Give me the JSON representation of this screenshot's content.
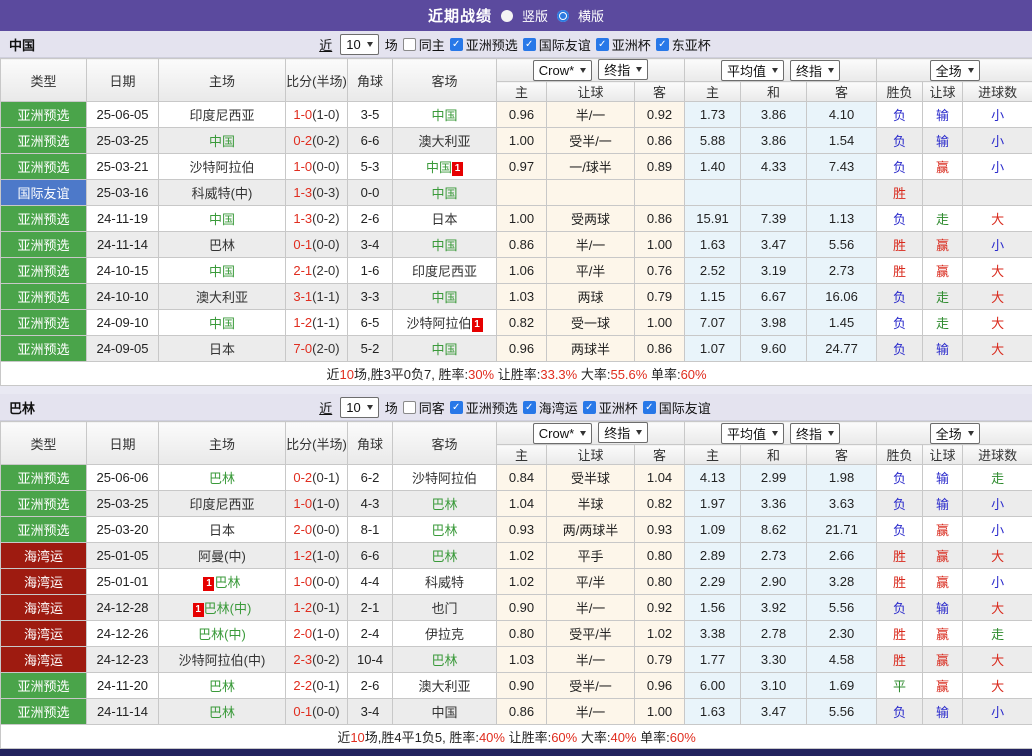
{
  "title_bar": {
    "title": "近期战绩",
    "radios": [
      {
        "label": "竖版",
        "selected": false
      },
      {
        "label": "横版",
        "selected": true
      }
    ]
  },
  "colors": {
    "accent_purple": "#5b4a9e",
    "type_badge": {
      "亚洲预选": "#4aa44a",
      "国际友谊": "#4d79c9",
      "海湾运": "#9e1b10"
    },
    "result": {
      "胜": "#d9291c",
      "负": "#2b2bcc",
      "平": "#2e8b2e",
      "赢": "#d9291c",
      "输": "#2b2bcc",
      "走": "#2e8b2e",
      "大": "#d9291c",
      "小": "#2b2bcc"
    },
    "score_red": "#e02d1f",
    "team_green": "#3a9a3a",
    "badge_red": "#e60000"
  },
  "table_header": {
    "left_columns": [
      "类型",
      "日期",
      "主场",
      "比分(半场)",
      "角球",
      "客场"
    ],
    "selects": {
      "group1": [
        "Crow*",
        "终指"
      ],
      "group2": [
        "平均值",
        "终指"
      ],
      "group3": [
        "全场"
      ]
    },
    "sub_columns": [
      "主",
      "让球",
      "客",
      "主",
      "和",
      "客",
      "胜负",
      "让球",
      "进球数"
    ]
  },
  "sections": [
    {
      "team": "中国",
      "filter": {
        "prefix": "近",
        "count": "10",
        "suffix": "场",
        "same": {
          "label": "同主",
          "checked": false
        },
        "leagues": [
          {
            "label": "亚洲预选",
            "checked": true
          },
          {
            "label": "国际友谊",
            "checked": true
          },
          {
            "label": "亚洲杯",
            "checked": true
          },
          {
            "label": "东亚杯",
            "checked": true
          }
        ]
      },
      "rows": [
        {
          "type": "亚洲预选",
          "date": "25-06-05",
          "home": {
            "name": "印度尼西亚"
          },
          "score": {
            "ft": "1-0",
            "ht": "(1-0)"
          },
          "corner": "3-5",
          "away": {
            "name": "中国",
            "green": true
          },
          "crow": [
            "0.96",
            "半/一",
            "0.92"
          ],
          "avg": [
            "1.73",
            "3.86",
            "4.10"
          ],
          "result": [
            "负",
            "输",
            "小"
          ]
        },
        {
          "type": "亚洲预选",
          "date": "25-03-25",
          "home": {
            "name": "中国",
            "green": true
          },
          "score": {
            "ft": "0-2",
            "ht": "(0-2)"
          },
          "corner": "6-6",
          "away": {
            "name": "澳大利亚"
          },
          "crow": [
            "1.00",
            "受半/一",
            "0.86"
          ],
          "avg": [
            "5.88",
            "3.86",
            "1.54"
          ],
          "result": [
            "负",
            "输",
            "小"
          ]
        },
        {
          "type": "亚洲预选",
          "date": "25-03-21",
          "home": {
            "name": "沙特阿拉伯"
          },
          "score": {
            "ft": "1-0",
            "ht": "(0-0)"
          },
          "corner": "5-3",
          "away": {
            "name": "中国",
            "green": true,
            "badge": "1",
            "badge_pos": "after"
          },
          "crow": [
            "0.97",
            "一/球半",
            "0.89"
          ],
          "avg": [
            "1.40",
            "4.33",
            "7.43"
          ],
          "result": [
            "负",
            "赢",
            "小"
          ]
        },
        {
          "type": "国际友谊",
          "date": "25-03-16",
          "home": {
            "name": "科威特(中)"
          },
          "score": {
            "ft": "1-3",
            "ht": "(0-3)"
          },
          "corner": "0-0",
          "away": {
            "name": "中国",
            "green": true
          },
          "crow": [
            "",
            "",
            ""
          ],
          "avg": [
            "",
            "",
            ""
          ],
          "result": [
            "胜",
            "",
            ""
          ]
        },
        {
          "type": "亚洲预选",
          "date": "24-11-19",
          "home": {
            "name": "中国",
            "green": true
          },
          "score": {
            "ft": "1-3",
            "ht": "(0-2)"
          },
          "corner": "2-6",
          "away": {
            "name": "日本"
          },
          "crow": [
            "1.00",
            "受两球",
            "0.86"
          ],
          "avg": [
            "15.91",
            "7.39",
            "1.13"
          ],
          "result": [
            "负",
            "走",
            "大"
          ]
        },
        {
          "type": "亚洲预选",
          "date": "24-11-14",
          "home": {
            "name": "巴林"
          },
          "score": {
            "ft": "0-1",
            "ht": "(0-0)"
          },
          "corner": "3-4",
          "away": {
            "name": "中国",
            "green": true
          },
          "crow": [
            "0.86",
            "半/一",
            "1.00"
          ],
          "avg": [
            "1.63",
            "3.47",
            "5.56"
          ],
          "result": [
            "胜",
            "赢",
            "小"
          ]
        },
        {
          "type": "亚洲预选",
          "date": "24-10-15",
          "home": {
            "name": "中国",
            "green": true
          },
          "score": {
            "ft": "2-1",
            "ht": "(2-0)"
          },
          "corner": "1-6",
          "away": {
            "name": "印度尼西亚"
          },
          "crow": [
            "1.06",
            "平/半",
            "0.76"
          ],
          "avg": [
            "2.52",
            "3.19",
            "2.73"
          ],
          "result": [
            "胜",
            "赢",
            "大"
          ]
        },
        {
          "type": "亚洲预选",
          "date": "24-10-10",
          "home": {
            "name": "澳大利亚"
          },
          "score": {
            "ft": "3-1",
            "ht": "(1-1)"
          },
          "corner": "3-3",
          "away": {
            "name": "中国",
            "green": true
          },
          "crow": [
            "1.03",
            "两球",
            "0.79"
          ],
          "avg": [
            "1.15",
            "6.67",
            "16.06"
          ],
          "result": [
            "负",
            "走",
            "大"
          ]
        },
        {
          "type": "亚洲预选",
          "date": "24-09-10",
          "home": {
            "name": "中国",
            "green": true
          },
          "score": {
            "ft": "1-2",
            "ht": "(1-1)"
          },
          "corner": "6-5",
          "away": {
            "name": "沙特阿拉伯",
            "badge": "1",
            "badge_pos": "after"
          },
          "crow": [
            "0.82",
            "受一球",
            "1.00"
          ],
          "avg": [
            "7.07",
            "3.98",
            "1.45"
          ],
          "result": [
            "负",
            "走",
            "大"
          ]
        },
        {
          "type": "亚洲预选",
          "date": "24-09-05",
          "home": {
            "name": "日本"
          },
          "score": {
            "ft": "7-0",
            "ht": "(2-0)"
          },
          "corner": "5-2",
          "away": {
            "name": "中国",
            "green": true
          },
          "crow": [
            "0.96",
            "两球半",
            "0.86"
          ],
          "avg": [
            "1.07",
            "9.60",
            "24.77"
          ],
          "result": [
            "负",
            "输",
            "大"
          ]
        }
      ],
      "summary": [
        {
          "text": "近",
          "red": false
        },
        {
          "text": "10",
          "red": true
        },
        {
          "text": "场,胜3平0负7, 胜率:",
          "red": false
        },
        {
          "text": "30%",
          "red": true
        },
        {
          "text": " 让胜率:",
          "red": false
        },
        {
          "text": "33.3%",
          "red": true
        },
        {
          "text": " 大率:",
          "red": false
        },
        {
          "text": "55.6%",
          "red": true
        },
        {
          "text": " 单率:",
          "red": false
        },
        {
          "text": "60%",
          "red": true
        }
      ]
    },
    {
      "team": "巴林",
      "filter": {
        "prefix": "近",
        "count": "10",
        "suffix": "场",
        "same": {
          "label": "同客",
          "checked": false
        },
        "leagues": [
          {
            "label": "亚洲预选",
            "checked": true
          },
          {
            "label": "海湾运",
            "checked": true
          },
          {
            "label": "亚洲杯",
            "checked": true
          },
          {
            "label": "国际友谊",
            "checked": true
          }
        ]
      },
      "rows": [
        {
          "type": "亚洲预选",
          "date": "25-06-06",
          "home": {
            "name": "巴林",
            "green": true
          },
          "score": {
            "ft": "0-2",
            "ht": "(0-1)"
          },
          "corner": "6-2",
          "away": {
            "name": "沙特阿拉伯"
          },
          "crow": [
            "0.84",
            "受半球",
            "1.04"
          ],
          "avg": [
            "4.13",
            "2.99",
            "1.98"
          ],
          "result": [
            "负",
            "输",
            "走"
          ]
        },
        {
          "type": "亚洲预选",
          "date": "25-03-25",
          "home": {
            "name": "印度尼西亚"
          },
          "score": {
            "ft": "1-0",
            "ht": "(1-0)"
          },
          "corner": "4-3",
          "away": {
            "name": "巴林",
            "green": true
          },
          "crow": [
            "1.04",
            "半球",
            "0.82"
          ],
          "avg": [
            "1.97",
            "3.36",
            "3.63"
          ],
          "result": [
            "负",
            "输",
            "小"
          ]
        },
        {
          "type": "亚洲预选",
          "date": "25-03-20",
          "home": {
            "name": "日本"
          },
          "score": {
            "ft": "2-0",
            "ht": "(0-0)"
          },
          "corner": "8-1",
          "away": {
            "name": "巴林",
            "green": true
          },
          "crow": [
            "0.93",
            "两/两球半",
            "0.93"
          ],
          "avg": [
            "1.09",
            "8.62",
            "21.71"
          ],
          "result": [
            "负",
            "赢",
            "小"
          ]
        },
        {
          "type": "海湾运",
          "date": "25-01-05",
          "home": {
            "name": "阿曼(中)"
          },
          "score": {
            "ft": "1-2",
            "ht": "(1-0)"
          },
          "corner": "6-6",
          "away": {
            "name": "巴林",
            "green": true
          },
          "crow": [
            "1.02",
            "平手",
            "0.80"
          ],
          "avg": [
            "2.89",
            "2.73",
            "2.66"
          ],
          "result": [
            "胜",
            "赢",
            "大"
          ]
        },
        {
          "type": "海湾运",
          "date": "25-01-01",
          "home": {
            "name": "巴林",
            "green": true,
            "badge": "1",
            "badge_pos": "before"
          },
          "score": {
            "ft": "1-0",
            "ht": "(0-0)"
          },
          "corner": "4-4",
          "away": {
            "name": "科威特"
          },
          "crow": [
            "1.02",
            "平/半",
            "0.80"
          ],
          "avg": [
            "2.29",
            "2.90",
            "3.28"
          ],
          "result": [
            "胜",
            "赢",
            "小"
          ]
        },
        {
          "type": "海湾运",
          "date": "24-12-28",
          "home": {
            "name": "巴林(中)",
            "green": true,
            "badge": "1",
            "badge_pos": "before"
          },
          "score": {
            "ft": "1-2",
            "ht": "(0-1)"
          },
          "corner": "2-1",
          "away": {
            "name": "也门"
          },
          "crow": [
            "0.90",
            "半/一",
            "0.92"
          ],
          "avg": [
            "1.56",
            "3.92",
            "5.56"
          ],
          "result": [
            "负",
            "输",
            "大"
          ]
        },
        {
          "type": "海湾运",
          "date": "24-12-26",
          "home": {
            "name": "巴林(中)",
            "green": true
          },
          "score": {
            "ft": "2-0",
            "ht": "(1-0)"
          },
          "corner": "2-4",
          "away": {
            "name": "伊拉克"
          },
          "crow": [
            "0.80",
            "受平/半",
            "1.02"
          ],
          "avg": [
            "3.38",
            "2.78",
            "2.30"
          ],
          "result": [
            "胜",
            "赢",
            "走"
          ]
        },
        {
          "type": "海湾运",
          "date": "24-12-23",
          "home": {
            "name": "沙特阿拉伯(中)"
          },
          "score": {
            "ft": "2-3",
            "ht": "(0-2)"
          },
          "corner": "10-4",
          "away": {
            "name": "巴林",
            "green": true
          },
          "crow": [
            "1.03",
            "半/一",
            "0.79"
          ],
          "avg": [
            "1.77",
            "3.30",
            "4.58"
          ],
          "result": [
            "胜",
            "赢",
            "大"
          ]
        },
        {
          "type": "亚洲预选",
          "date": "24-11-20",
          "home": {
            "name": "巴林",
            "green": true
          },
          "score": {
            "ft": "2-2",
            "ht": "(0-1)"
          },
          "corner": "2-6",
          "away": {
            "name": "澳大利亚"
          },
          "crow": [
            "0.90",
            "受半/一",
            "0.96"
          ],
          "avg": [
            "6.00",
            "3.10",
            "1.69"
          ],
          "result": [
            "平",
            "赢",
            "大"
          ]
        },
        {
          "type": "亚洲预选",
          "date": "24-11-14",
          "home": {
            "name": "巴林",
            "green": true
          },
          "score": {
            "ft": "0-1",
            "ht": "(0-0)"
          },
          "corner": "3-4",
          "away": {
            "name": "中国"
          },
          "crow": [
            "0.86",
            "半/一",
            "1.00"
          ],
          "avg": [
            "1.63",
            "3.47",
            "5.56"
          ],
          "result": [
            "负",
            "输",
            "小"
          ]
        }
      ],
      "summary": [
        {
          "text": "近",
          "red": false
        },
        {
          "text": "10",
          "red": true
        },
        {
          "text": "场,胜4平1负5, 胜率:",
          "red": false
        },
        {
          "text": "40%",
          "red": true
        },
        {
          "text": " 让胜率:",
          "red": false
        },
        {
          "text": "60%",
          "red": true
        },
        {
          "text": " 大率:",
          "red": false
        },
        {
          "text": "40%",
          "red": true
        },
        {
          "text": " 单率:",
          "red": false
        },
        {
          "text": "60%",
          "red": true
        }
      ]
    }
  ]
}
